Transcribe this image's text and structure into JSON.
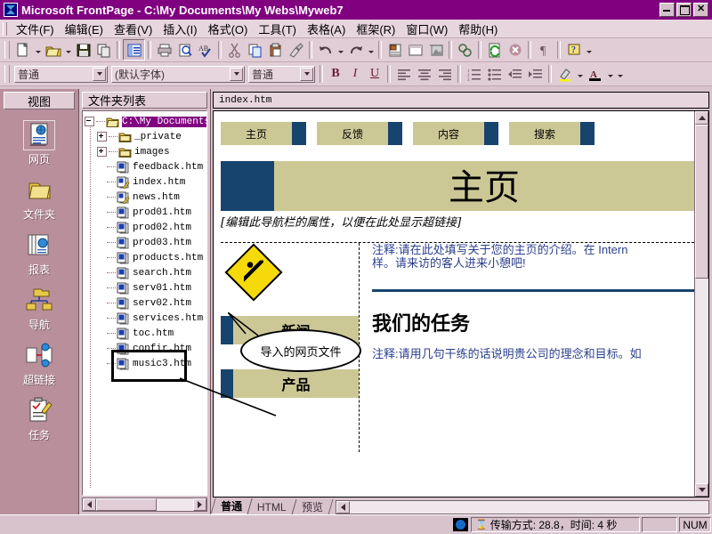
{
  "window": {
    "title": "Microsoft FrontPage - C:\\My Documents\\My Webs\\Myweb7",
    "icon": "frontpage-icon",
    "minimize_label": "",
    "restore_label": "",
    "close_label": "×"
  },
  "menubar": {
    "items": [
      {
        "label": "文件(F)",
        "name": "menu-file"
      },
      {
        "label": "编辑(E)",
        "name": "menu-edit"
      },
      {
        "label": "查看(V)",
        "name": "menu-view"
      },
      {
        "label": "插入(I)",
        "name": "menu-insert"
      },
      {
        "label": "格式(O)",
        "name": "menu-format"
      },
      {
        "label": "工具(T)",
        "name": "menu-tools"
      },
      {
        "label": "表格(A)",
        "name": "menu-table"
      },
      {
        "label": "框架(R)",
        "name": "menu-frames"
      },
      {
        "label": "窗口(W)",
        "name": "menu-window"
      },
      {
        "label": "帮助(H)",
        "name": "menu-help"
      }
    ]
  },
  "standard_toolbar": {
    "buttons": [
      "new-page-icon",
      "open-folder-icon",
      "save-icon",
      "publish-icon",
      "toggle-folder-list-icon",
      "print-icon",
      "print-preview-icon",
      "spelling-icon",
      "cut-icon",
      "copy-icon",
      "paste-icon",
      "format-painter-icon",
      "undo-icon",
      "redo-icon",
      "insert-component-icon",
      "insert-table-icon",
      "insert-image-icon",
      "hyperlink-icon",
      "refresh-icon",
      "stop-icon",
      "show-marks-icon",
      "help-icon"
    ]
  },
  "format_toolbar": {
    "style_value": "普通",
    "font_value": "(默认字体)",
    "size_value": "普通",
    "bold_label": "B",
    "italic_label": "I",
    "underline_label": "U",
    "buttons": [
      "align-left-icon",
      "align-center-icon",
      "align-right-icon",
      "numbered-list-icon",
      "bulleted-list-icon",
      "decrease-indent-icon",
      "increase-indent-icon",
      "highlight-color-icon",
      "font-color-icon"
    ]
  },
  "views_bar": {
    "header": "视图",
    "items": [
      {
        "label": "网页",
        "icon": "page-view-icon",
        "active": true
      },
      {
        "label": "文件夹",
        "icon": "folders-view-icon",
        "active": false
      },
      {
        "label": "报表",
        "icon": "reports-view-icon",
        "active": false
      },
      {
        "label": "导航",
        "icon": "navigation-view-icon",
        "active": false
      },
      {
        "label": "超链接",
        "icon": "hyperlinks-view-icon",
        "active": false
      },
      {
        "label": "任务",
        "icon": "tasks-view-icon",
        "active": false
      }
    ]
  },
  "folder_list": {
    "header": "文件夹列表",
    "nodes": [
      {
        "label": "C:\\My Documents\\M",
        "icon": "open-folder-icon",
        "indent": 0,
        "expander": "minus",
        "selected": true
      },
      {
        "label": "_private",
        "icon": "folder-icon",
        "indent": 1,
        "expander": "plus",
        "selected": false
      },
      {
        "label": "images",
        "icon": "folder-icon",
        "indent": 1,
        "expander": "plus",
        "selected": false
      },
      {
        "label": "feedback.htm",
        "icon": "web-page-icon",
        "indent": 1,
        "expander": "none",
        "selected": false
      },
      {
        "label": "index.htm",
        "icon": "home-page-icon",
        "indent": 1,
        "expander": "none",
        "selected": false
      },
      {
        "label": "news.htm",
        "icon": "home-page-icon",
        "indent": 1,
        "expander": "none",
        "selected": false
      },
      {
        "label": "prod01.htm",
        "icon": "web-page-icon",
        "indent": 1,
        "expander": "none",
        "selected": false
      },
      {
        "label": "prod02.htm",
        "icon": "web-page-icon",
        "indent": 1,
        "expander": "none",
        "selected": false
      },
      {
        "label": "prod03.htm",
        "icon": "web-page-icon",
        "indent": 1,
        "expander": "none",
        "selected": false
      },
      {
        "label": "products.htm",
        "icon": "web-page-icon",
        "indent": 1,
        "expander": "none",
        "selected": false
      },
      {
        "label": "search.htm",
        "icon": "web-page-icon",
        "indent": 1,
        "expander": "none",
        "selected": false
      },
      {
        "label": "serv01.htm",
        "icon": "web-page-icon",
        "indent": 1,
        "expander": "none",
        "selected": false
      },
      {
        "label": "serv02.htm",
        "icon": "web-page-icon",
        "indent": 1,
        "expander": "none",
        "selected": false
      },
      {
        "label": "services.htm",
        "icon": "web-page-icon",
        "indent": 1,
        "expander": "none",
        "selected": false
      },
      {
        "label": "toc.htm",
        "icon": "web-page-icon",
        "indent": 1,
        "expander": "none",
        "selected": false
      },
      {
        "label": "confir.htm",
        "icon": "web-page-icon",
        "indent": 1,
        "expander": "none",
        "selected": false
      },
      {
        "label": "music3.htm",
        "icon": "web-page-icon",
        "indent": 1,
        "expander": "none",
        "selected": false
      }
    ]
  },
  "annotation": {
    "callout_text": "导入的网页文件",
    "highlight_color": "#000000"
  },
  "editor": {
    "document_tab": "index.htm",
    "view_tabs": [
      {
        "label": "普通",
        "active": true
      },
      {
        "label": "HTML",
        "active": false
      },
      {
        "label": "预览",
        "active": false
      }
    ]
  },
  "webpage": {
    "nav_links": [
      "主页",
      "反馈",
      "内容",
      "搜索"
    ],
    "banner_title": "主页",
    "nav_hint": "[编辑此导航栏的属性，以便在此处显示超链接]",
    "intro_comment_line1": "注释:请在此处填写关于您的主页的介绍。在 Intern",
    "intro_comment_line2": "样。请来访的客人进来小憩吧!",
    "section_news": "新闻",
    "section_products": "产品",
    "mission_heading": "我们的任务",
    "mission_comment": "注释:请用几句干练的话说明贵公司的理念和目标。如",
    "construction_icon": "under-construction-icon",
    "colors": {
      "khaki": "#ccc896",
      "navy": "#17446e",
      "comment_blue": "#2b3f8c"
    }
  },
  "statusbar": {
    "net_icon": "network-icon",
    "hourglass_icon": "hourglass-icon",
    "transfer_text": "传输方式: 28.8，时间: 4 秒",
    "num_lock": "NUM"
  }
}
